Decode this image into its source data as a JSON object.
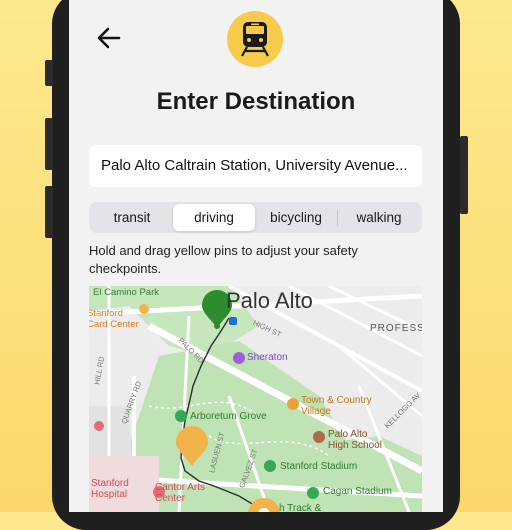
{
  "screen": {
    "title": "Enter Destination",
    "destination_value": "Palo Alto Caltrain Station, University Avenue...",
    "modes": [
      {
        "label": "transit",
        "selected": false
      },
      {
        "label": "driving",
        "selected": true
      },
      {
        "label": "bicycling",
        "selected": false
      },
      {
        "label": "walking",
        "selected": false
      }
    ],
    "instructions": "Hold and drag yellow pins to adjust your safety checkpoints."
  },
  "map": {
    "labels": {
      "el_camino_park": "El Camino Park",
      "palo_alto": "Palo Alto",
      "stanford_card_center": "Stanford\nCard Center",
      "high_st": "HIGH ST",
      "professo": "PROFESSO",
      "palo_rd": "PALO RD",
      "sheraton": "Sheraton",
      "hill_rd": "HILL RD",
      "quarry_rd": "QUARRY RD",
      "town_country": "Town & Country\nVillage",
      "kellogg_av": "KELLOGG AV",
      "arboretum_grove": "Arboretum Grove",
      "palo_alto_high": "Palo Alto\nHigh School",
      "lasuen_st": "LASUEN ST",
      "galvez_st": "GALVEZ ST",
      "stanford_stadium": "Stanford Stadium",
      "stanford_hospital": "Stanford\nHospital",
      "cantor_arts": "Cantor Arts\nCenter",
      "cagan_stadium": "Cagan Stadium",
      "track": "h Track &"
    },
    "pins": {
      "start_color": "#2e8b2e",
      "checkpoint_color": "#f2b44a"
    }
  },
  "colors": {
    "accent_yellow": "#f7cc4d",
    "park_green": "#bfe3b4",
    "poi_green": "#34a853",
    "poi_orange": "#e8a33a",
    "poi_purple": "#a05ed8",
    "poi_brown": "#b0684a",
    "poi_pink": "#e56a78"
  }
}
